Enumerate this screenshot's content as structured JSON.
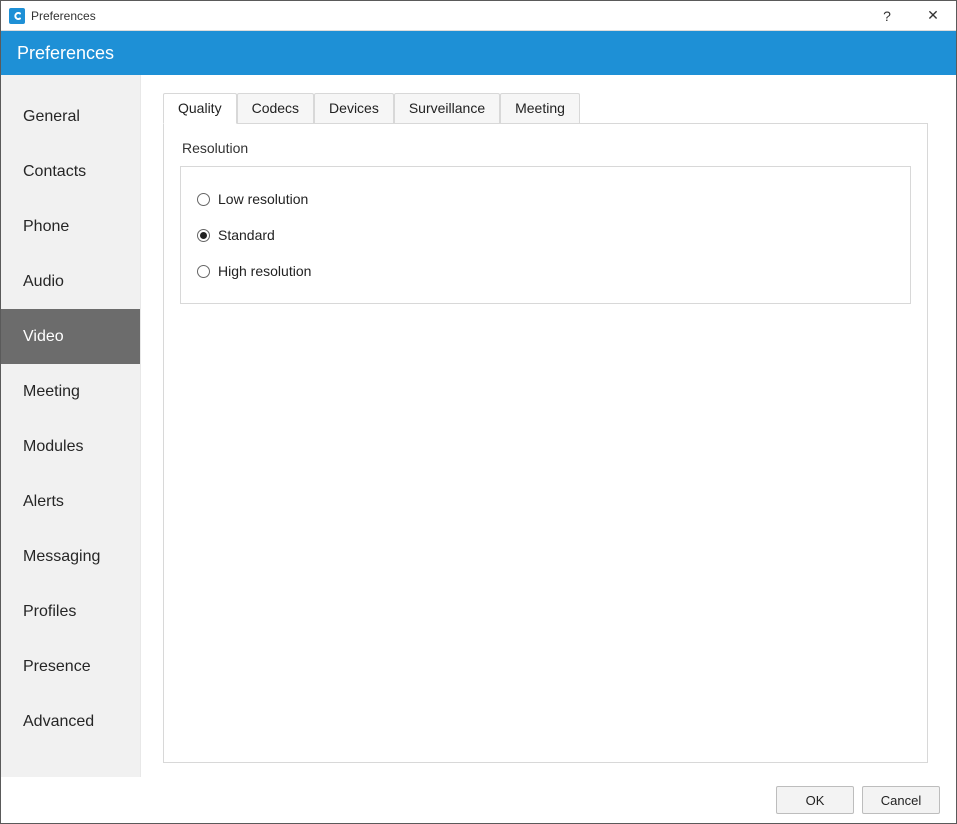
{
  "window": {
    "title": "Preferences",
    "help_glyph": "?",
    "close_glyph": "✕"
  },
  "banner": {
    "title": "Preferences"
  },
  "sidebar": {
    "items": [
      {
        "label": "General",
        "selected": false
      },
      {
        "label": "Contacts",
        "selected": false
      },
      {
        "label": "Phone",
        "selected": false
      },
      {
        "label": "Audio",
        "selected": false
      },
      {
        "label": "Video",
        "selected": true
      },
      {
        "label": "Meeting",
        "selected": false
      },
      {
        "label": "Modules",
        "selected": false
      },
      {
        "label": "Alerts",
        "selected": false
      },
      {
        "label": "Messaging",
        "selected": false
      },
      {
        "label": "Profiles",
        "selected": false
      },
      {
        "label": "Presence",
        "selected": false
      },
      {
        "label": "Advanced",
        "selected": false
      }
    ]
  },
  "tabs": [
    {
      "label": "Quality",
      "active": true
    },
    {
      "label": "Codecs",
      "active": false
    },
    {
      "label": "Devices",
      "active": false
    },
    {
      "label": "Surveillance",
      "active": false
    },
    {
      "label": "Meeting",
      "active": false
    }
  ],
  "resolution": {
    "legend": "Resolution",
    "options": [
      {
        "label": "Low resolution",
        "checked": false
      },
      {
        "label": "Standard",
        "checked": true
      },
      {
        "label": "High resolution",
        "checked": false
      }
    ]
  },
  "footer": {
    "ok_label": "OK",
    "cancel_label": "Cancel"
  },
  "colors": {
    "accent": "#1e90d6",
    "sidebar_selected_bg": "#6c6c6c"
  }
}
